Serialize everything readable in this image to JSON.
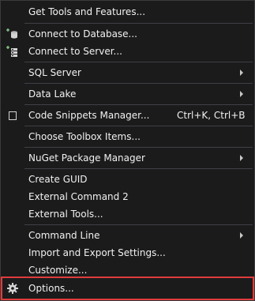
{
  "menu": {
    "items": [
      {
        "label": "Get Tools and Features..."
      },
      {
        "label": "Connect to Database...",
        "icon": "database-add-icon"
      },
      {
        "label": "Connect to Server...",
        "icon": "server-add-icon"
      },
      {
        "label": "SQL Server",
        "submenu": true
      },
      {
        "label": "Data Lake",
        "submenu": true
      },
      {
        "label": "Code Snippets Manager...",
        "shortcut": "Ctrl+K, Ctrl+B",
        "icon": "checkbox-icon"
      },
      {
        "label": "Choose Toolbox Items..."
      },
      {
        "label": "NuGet Package Manager",
        "submenu": true
      },
      {
        "label": "Create GUID"
      },
      {
        "label": "External Command 2"
      },
      {
        "label": "External Tools..."
      },
      {
        "label": "Command Line",
        "submenu": true
      },
      {
        "label": "Import and Export Settings..."
      },
      {
        "label": "Customize..."
      },
      {
        "label": "Options...",
        "icon": "gear-icon"
      }
    ]
  },
  "colors": {
    "background": "#1b1b1c",
    "text": "#f1f1f1",
    "separator": "#3f3f46",
    "highlight_border": "#e03c3c",
    "icon_accent": "#8dd28d"
  }
}
